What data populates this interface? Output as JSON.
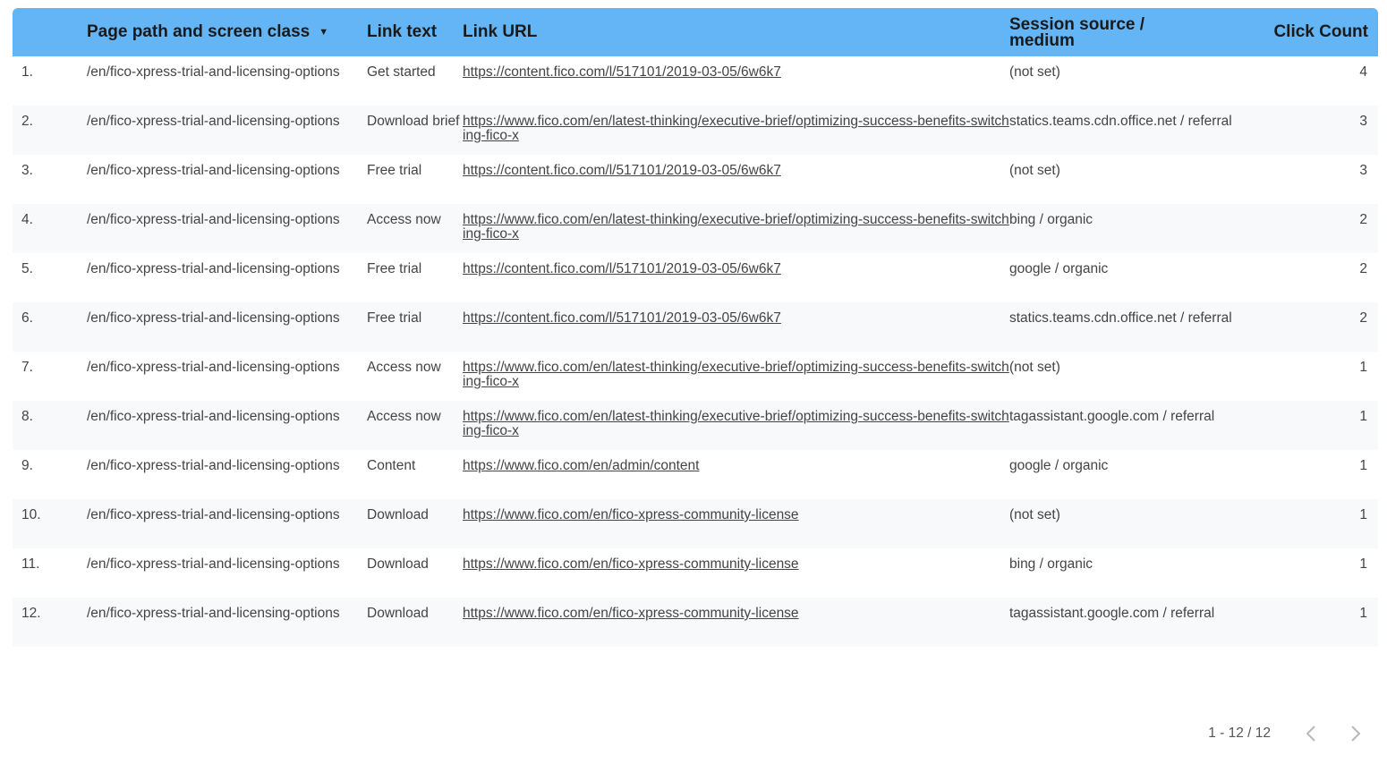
{
  "table": {
    "columns": {
      "index": "",
      "page_path": "Page path and screen class",
      "link_text": "Link text",
      "link_url": "Link URL",
      "session_source_line1": "Session source /",
      "session_source_line2": "medium",
      "click_count": "Click Count"
    },
    "sort_icon": "▼",
    "rows": [
      {
        "index": "1.",
        "page_path": "/en/fico-xpress-trial-and-licensing-options",
        "link_text": "Get started",
        "link_url": "https://content.fico.com/l/517101/2019-03-05/6w6k7",
        "source": "(not set)",
        "clicks": "4"
      },
      {
        "index": "2.",
        "page_path": "/en/fico-xpress-trial-and-licensing-options",
        "link_text": "Download brief",
        "link_url": "https://www.fico.com/en/latest-thinking/executive-brief/optimizing-success-benefits-switching-fico-x",
        "source": "statics.teams.cdn.office.net / referral",
        "clicks": "3"
      },
      {
        "index": "3.",
        "page_path": "/en/fico-xpress-trial-and-licensing-options",
        "link_text": "Free trial",
        "link_url": "https://content.fico.com/l/517101/2019-03-05/6w6k7",
        "source": "(not set)",
        "clicks": "3"
      },
      {
        "index": "4.",
        "page_path": "/en/fico-xpress-trial-and-licensing-options",
        "link_text": "Access now",
        "link_url": "https://www.fico.com/en/latest-thinking/executive-brief/optimizing-success-benefits-switching-fico-x",
        "source": "bing / organic",
        "clicks": "2"
      },
      {
        "index": "5.",
        "page_path": "/en/fico-xpress-trial-and-licensing-options",
        "link_text": "Free trial",
        "link_url": "https://content.fico.com/l/517101/2019-03-05/6w6k7",
        "source": "google / organic",
        "clicks": "2"
      },
      {
        "index": "6.",
        "page_path": "/en/fico-xpress-trial-and-licensing-options",
        "link_text": "Free trial",
        "link_url": "https://content.fico.com/l/517101/2019-03-05/6w6k7",
        "source": "statics.teams.cdn.office.net / referral",
        "clicks": "2"
      },
      {
        "index": "7.",
        "page_path": "/en/fico-xpress-trial-and-licensing-options",
        "link_text": "Access now",
        "link_url": "https://www.fico.com/en/latest-thinking/executive-brief/optimizing-success-benefits-switching-fico-x",
        "source": "(not set)",
        "clicks": "1"
      },
      {
        "index": "8.",
        "page_path": "/en/fico-xpress-trial-and-licensing-options",
        "link_text": "Access now",
        "link_url": "https://www.fico.com/en/latest-thinking/executive-brief/optimizing-success-benefits-switching-fico-x",
        "source": "tagassistant.google.com / referral",
        "clicks": "1"
      },
      {
        "index": "9.",
        "page_path": "/en/fico-xpress-trial-and-licensing-options",
        "link_text": "Content",
        "link_url": "https://www.fico.com/en/admin/content",
        "source": "google / organic",
        "clicks": "1"
      },
      {
        "index": "10.",
        "page_path": "/en/fico-xpress-trial-and-licensing-options",
        "link_text": "Download",
        "link_url": "https://www.fico.com/en/fico-xpress-community-license",
        "source": "(not set)",
        "clicks": "1"
      },
      {
        "index": "11.",
        "page_path": "/en/fico-xpress-trial-and-licensing-options",
        "link_text": "Download",
        "link_url": "https://www.fico.com/en/fico-xpress-community-license",
        "source": "bing / organic",
        "clicks": "1"
      },
      {
        "index": "12.",
        "page_path": "/en/fico-xpress-trial-and-licensing-options",
        "link_text": "Download",
        "link_url": "https://www.fico.com/en/fico-xpress-community-license",
        "source": "tagassistant.google.com / referral",
        "clicks": "1"
      }
    ]
  },
  "pagination": {
    "label": "1 - 12 / 12",
    "prev_icon": "chevron-left-icon",
    "next_icon": "chevron-right-icon"
  },
  "colors": {
    "header_bg": "#64b5f6",
    "zebra_bg": "#f8f9fa",
    "text": "#444444"
  }
}
